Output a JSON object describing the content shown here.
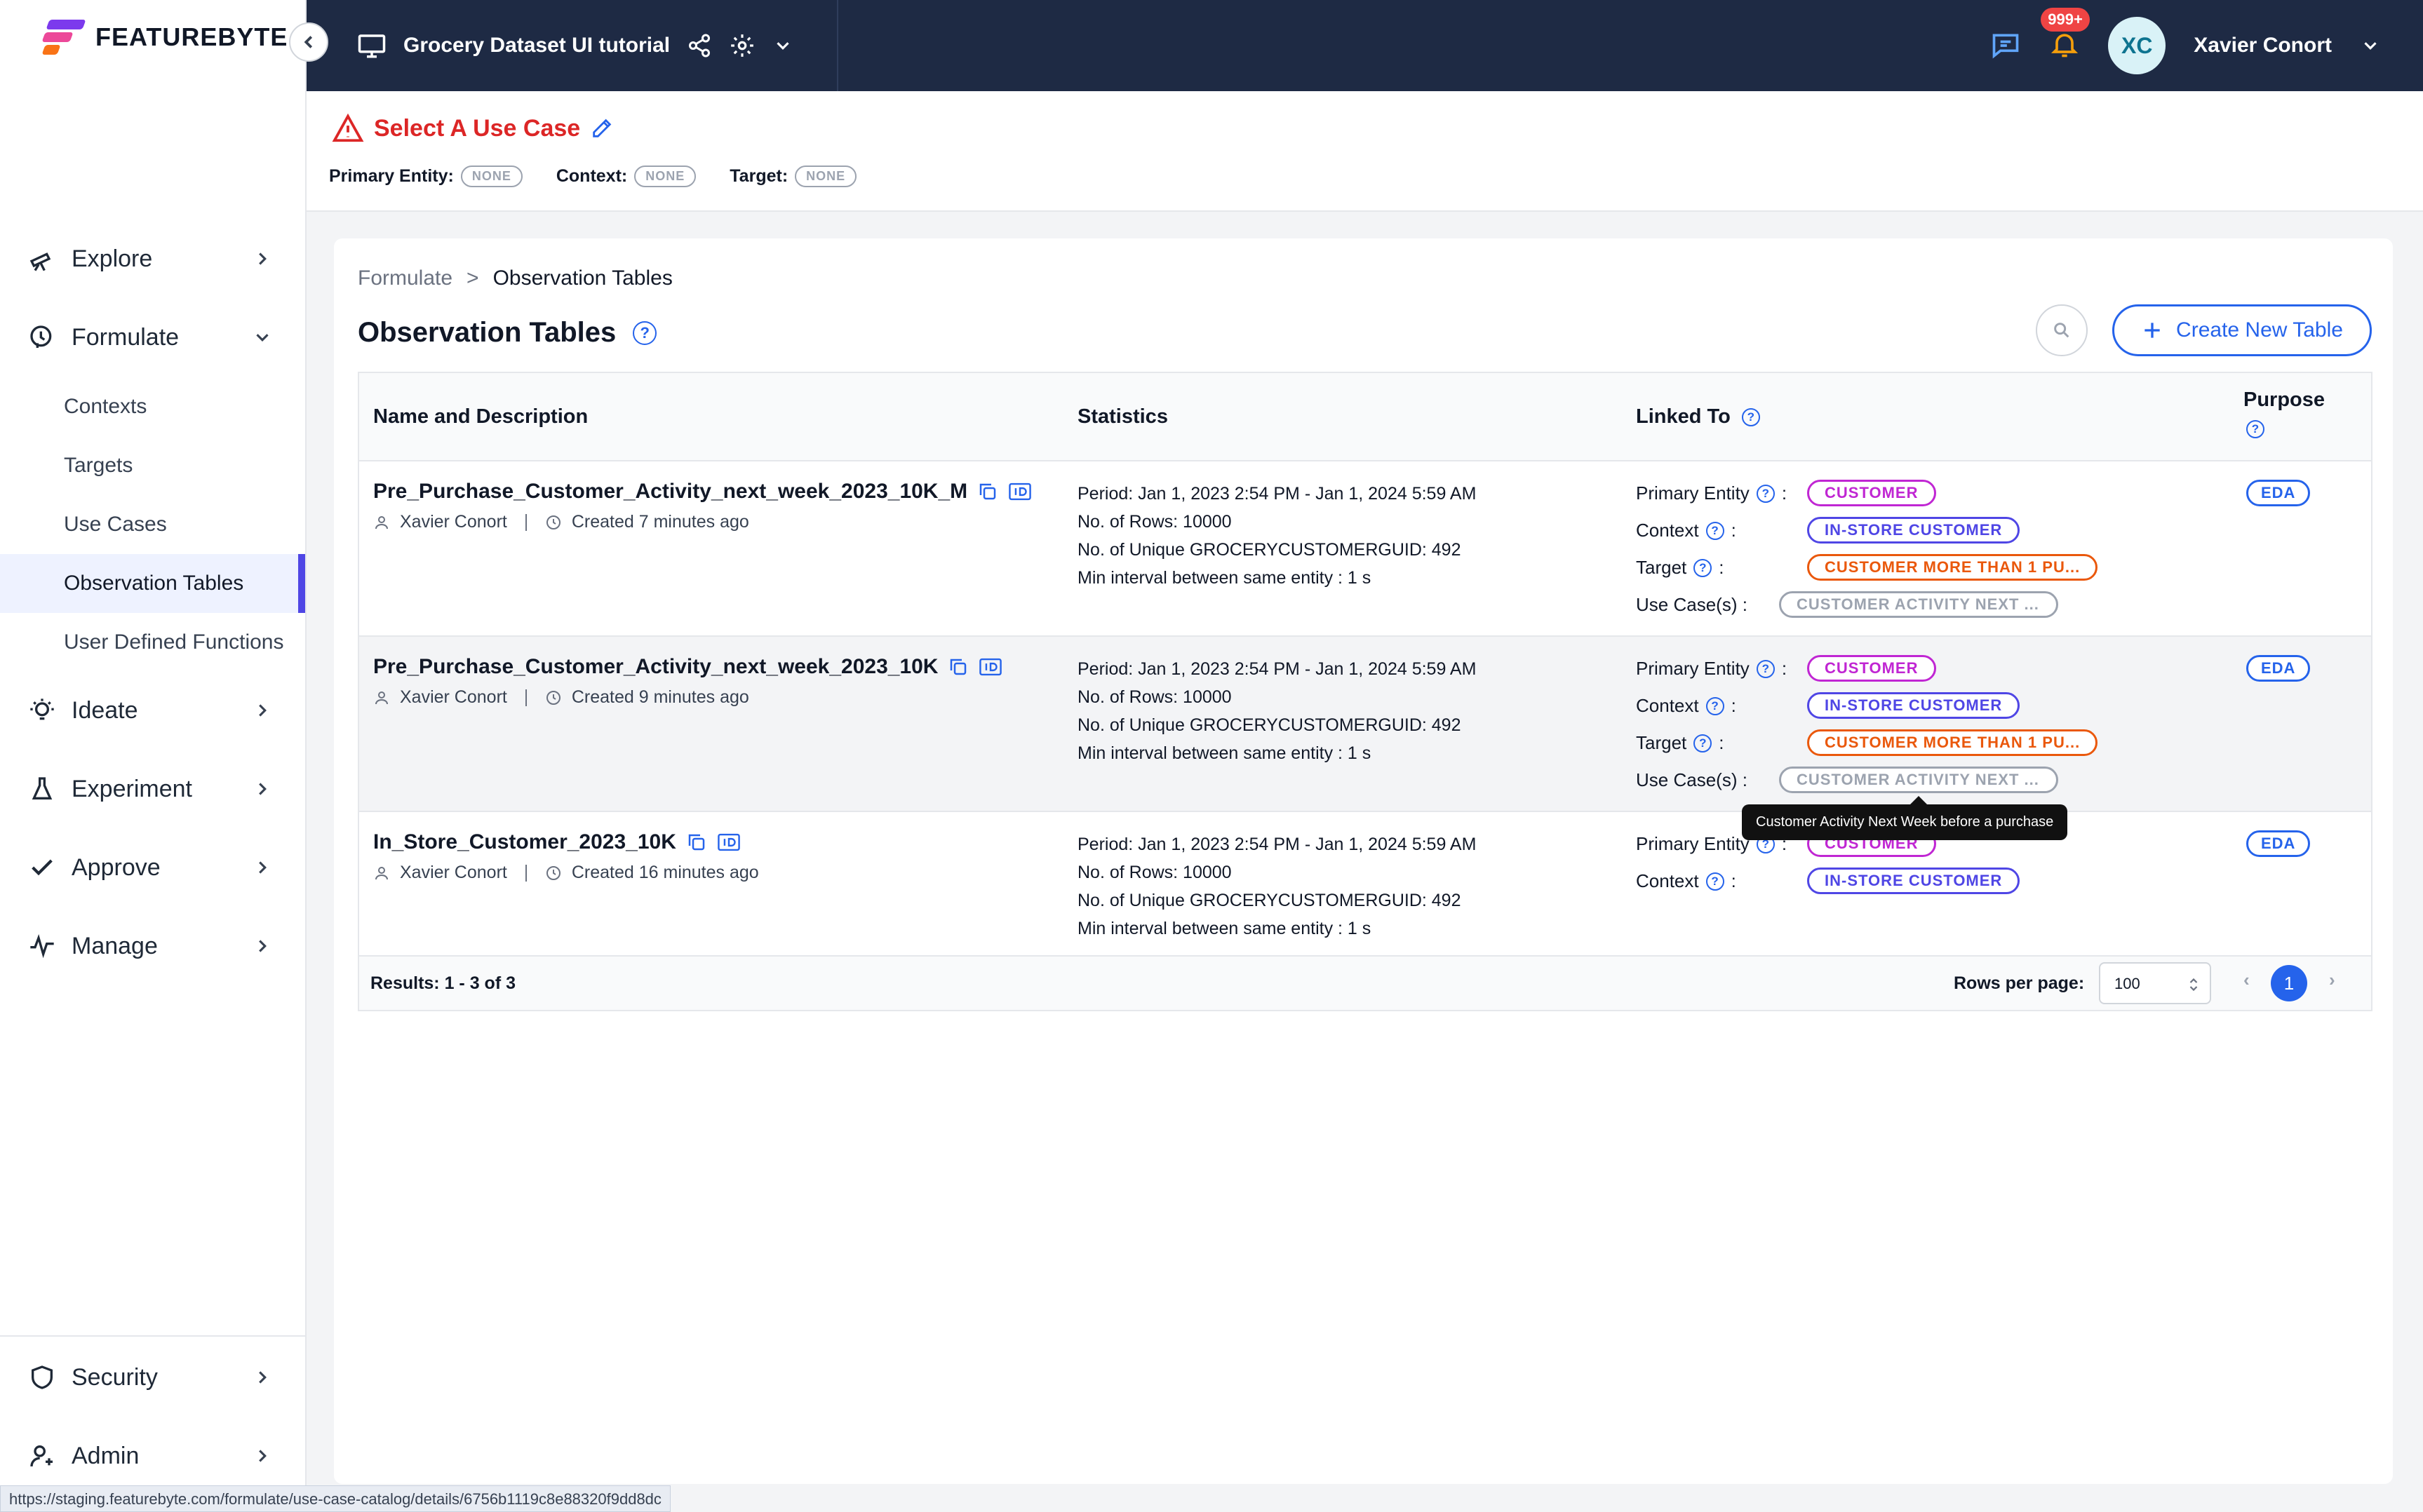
{
  "brand": {
    "name": "FEATUREBYTE"
  },
  "topbar": {
    "project_title": "Grocery Dataset UI tutorial",
    "notification_count": "999+",
    "user_initials": "XC",
    "user_name": "Xavier Conort"
  },
  "sidebar": {
    "items": [
      {
        "label": "Explore",
        "icon": "telescope-icon"
      },
      {
        "label": "Formulate",
        "icon": "brain-icon"
      },
      {
        "label": "Ideate",
        "icon": "lightbulb-icon"
      },
      {
        "label": "Experiment",
        "icon": "flask-icon"
      },
      {
        "label": "Approve",
        "icon": "check-icon"
      },
      {
        "label": "Manage",
        "icon": "pulse-icon"
      },
      {
        "label": "Security",
        "icon": "shield-icon"
      },
      {
        "label": "Admin",
        "icon": "user-admin-icon"
      }
    ],
    "formulate_sub": [
      "Contexts",
      "Targets",
      "Use Cases",
      "Observation Tables",
      "User Defined Functions"
    ]
  },
  "usecase": {
    "title": "Select A Use Case",
    "primary_entity_label": "Primary Entity:",
    "primary_entity_value": "NONE",
    "context_label": "Context:",
    "context_value": "NONE",
    "target_label": "Target:",
    "target_value": "NONE"
  },
  "breadcrumb": {
    "parent": "Formulate",
    "sep": ">",
    "current": "Observation Tables"
  },
  "page": {
    "title": "Observation Tables",
    "create_button": "Create New Table"
  },
  "table": {
    "headers": {
      "name": "Name and Description",
      "stats": "Statistics",
      "linked": "Linked To",
      "purpose": "Purpose"
    },
    "linked_labels": {
      "primary_entity": "Primary Entity",
      "context": "Context",
      "target": "Target",
      "use_cases": "Use Case(s) :",
      "colon": ":"
    },
    "rows": [
      {
        "name": "Pre_Purchase_Customer_Activity_next_week_2023_10K_M",
        "owner": "Xavier Conort",
        "created": "Created 7 minutes ago",
        "period": "Period: Jan 1, 2023 2:54 PM - Jan 1, 2024 5:59 AM",
        "rows": "No. of Rows: 10000",
        "unique": "No. of Unique GROCERYCUSTOMERGUID: 492",
        "interval": "Min interval between same entity : 1 s",
        "primary_entity": "CUSTOMER",
        "context": "IN-STORE CUSTOMER",
        "target": "CUSTOMER MORE THAN 1 PU...",
        "use_case": "CUSTOMER ACTIVITY NEXT ...",
        "purpose": "EDA"
      },
      {
        "name": "Pre_Purchase_Customer_Activity_next_week_2023_10K",
        "owner": "Xavier Conort",
        "created": "Created 9 minutes ago",
        "period": "Period: Jan 1, 2023 2:54 PM - Jan 1, 2024 5:59 AM",
        "rows": "No. of Rows: 10000",
        "unique": "No. of Unique GROCERYCUSTOMERGUID: 492",
        "interval": "Min interval between same entity : 1 s",
        "primary_entity": "CUSTOMER",
        "context": "IN-STORE CUSTOMER",
        "target": "CUSTOMER MORE THAN 1 PU...",
        "use_case": "CUSTOMER ACTIVITY NEXT ...",
        "purpose": "EDA"
      },
      {
        "name": "In_Store_Customer_2023_10K",
        "owner": "Xavier Conort",
        "created": "Created 16 minutes ago",
        "period": "Period: Jan 1, 2023 2:54 PM - Jan 1, 2024 5:59 AM",
        "rows": "No. of Rows: 10000",
        "unique": "No. of Unique GROCERYCUSTOMERGUID: 492",
        "interval": "Min interval between same entity : 1 s",
        "primary_entity": "CUSTOMER",
        "context": "IN-STORE CUSTOMER",
        "purpose": "EDA"
      }
    ],
    "footer": {
      "results": "Results: 1 - 3 of 3",
      "rows_per_page_label": "Rows per page:",
      "rows_per_page_value": "100",
      "current_page": "1"
    }
  },
  "tooltip": "Customer Activity Next Week before a purchase",
  "status_url": "https://staging.featurebyte.com/formulate/use-case-catalog/details/6756b1119c8e88320f9dd8dc",
  "colors": {
    "nav_bg": "#1e2a44",
    "accent": "#2563eb",
    "danger": "#dc2626",
    "entity": "#c026d3",
    "context": "#4f46e5",
    "target": "#ea580c"
  }
}
